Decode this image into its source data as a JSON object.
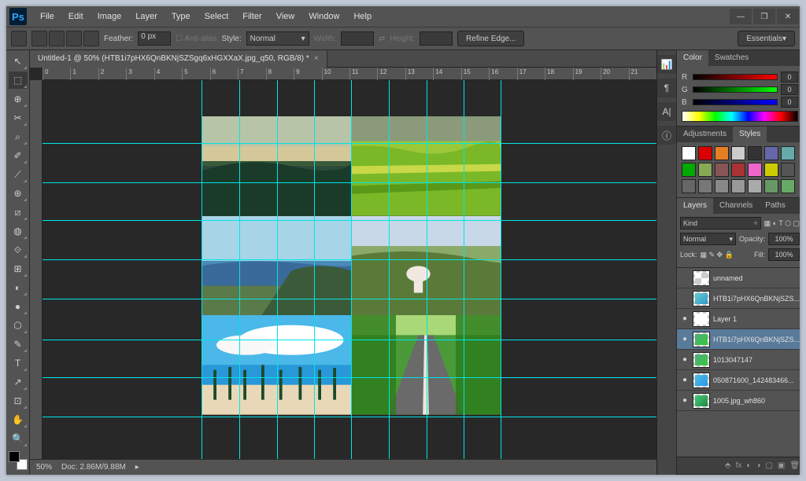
{
  "app": {
    "logo": "Ps"
  },
  "menu": [
    "File",
    "Edit",
    "Image",
    "Layer",
    "Type",
    "Select",
    "Filter",
    "View",
    "Window",
    "Help"
  ],
  "optbar": {
    "feather_label": "Feather:",
    "feather_value": "0 px",
    "antialias": "Anti-alias",
    "style_label": "Style:",
    "style_value": "Normal",
    "width_label": "Width:",
    "height_label": "Height:",
    "refine": "Refine Edge...",
    "workspace": "Essentials"
  },
  "doc_tab": {
    "title": "Untitled-1 @ 50% (HTB1i7pHX6QnBKNjSZSgq6xHGXXaX.jpg_q50, RGB/8) *"
  },
  "ruler_marks": [
    "0",
    "1",
    "2",
    "3",
    "4",
    "5",
    "6",
    "7",
    "8",
    "9",
    "10",
    "11",
    "12",
    "13",
    "14",
    "15",
    "16",
    "17",
    "18",
    "19",
    "20",
    "21"
  ],
  "status": {
    "zoom": "50%",
    "doc": "Doc: 2.86M/9.88M"
  },
  "panels": {
    "color": {
      "tabs": [
        "Color",
        "Swatches"
      ],
      "channels": [
        {
          "ch": "R",
          "bar": "linear-gradient(to right,#000,#f00)",
          "val": "0"
        },
        {
          "ch": "G",
          "bar": "linear-gradient(to right,#000,#0f0)",
          "val": "0"
        },
        {
          "ch": "B",
          "bar": "linear-gradient(to right,#000,#00f)",
          "val": "0"
        }
      ]
    },
    "adjust": {
      "tabs": [
        "Adjustments",
        "Styles"
      ]
    },
    "styles_colors": [
      "#fff",
      "#d00",
      "#e67e22",
      "#ccc",
      "#333",
      "#66a",
      "#6aa",
      "#0a0",
      "#8a5",
      "#855",
      "#a33",
      "#e6c",
      "#cc0",
      "#555",
      "#666",
      "#777",
      "#888",
      "#999",
      "#aaa",
      "#696",
      "#6a6"
    ],
    "layers": {
      "tabs": [
        "Layers",
        "Channels",
        "Paths"
      ],
      "kind": "Kind",
      "blend": "Normal",
      "opacity_label": "Opacity:",
      "opacity": "100%",
      "lock_label": "Lock:",
      "fill_label": "Fill:",
      "fill": "100%",
      "items": [
        {
          "vis": "",
          "name": "unnamed",
          "ov": "repeating-conic-gradient(#ccc 0 25%,#fff 0 50%)"
        },
        {
          "vis": "",
          "name": "HTB1i7pHX6QnBKNjSZS...",
          "ov": "linear-gradient(135deg,#6cc,#39c)"
        },
        {
          "vis": "●",
          "name": "Layer 1",
          "ov": "#fff"
        },
        {
          "vis": "●",
          "name": "HTB1i7pHX6QnBKNjSZS...",
          "ov": "linear-gradient(135deg,#5a8,#3c3)",
          "sel": true
        },
        {
          "vis": "●",
          "name": "1013047147",
          "ov": "linear-gradient(135deg,#5a8,#3c3)"
        },
        {
          "vis": "●",
          "name": "050871600_142483466...",
          "ov": "linear-gradient(135deg,#5bd,#29e)"
        },
        {
          "vis": "●",
          "name": "1005.jpg_wh860",
          "ov": "linear-gradient(135deg,#4c7,#284)"
        }
      ]
    }
  },
  "tools": [
    "↖",
    "⬚",
    "⊕",
    "✂",
    "⌕",
    "✐",
    "⟋",
    "⊛",
    "⧄",
    "◍",
    "⟐",
    "⊞",
    "◐",
    "●",
    "⬡",
    "✎",
    "T",
    "↗",
    "⊡",
    "✋",
    "🔍"
  ]
}
